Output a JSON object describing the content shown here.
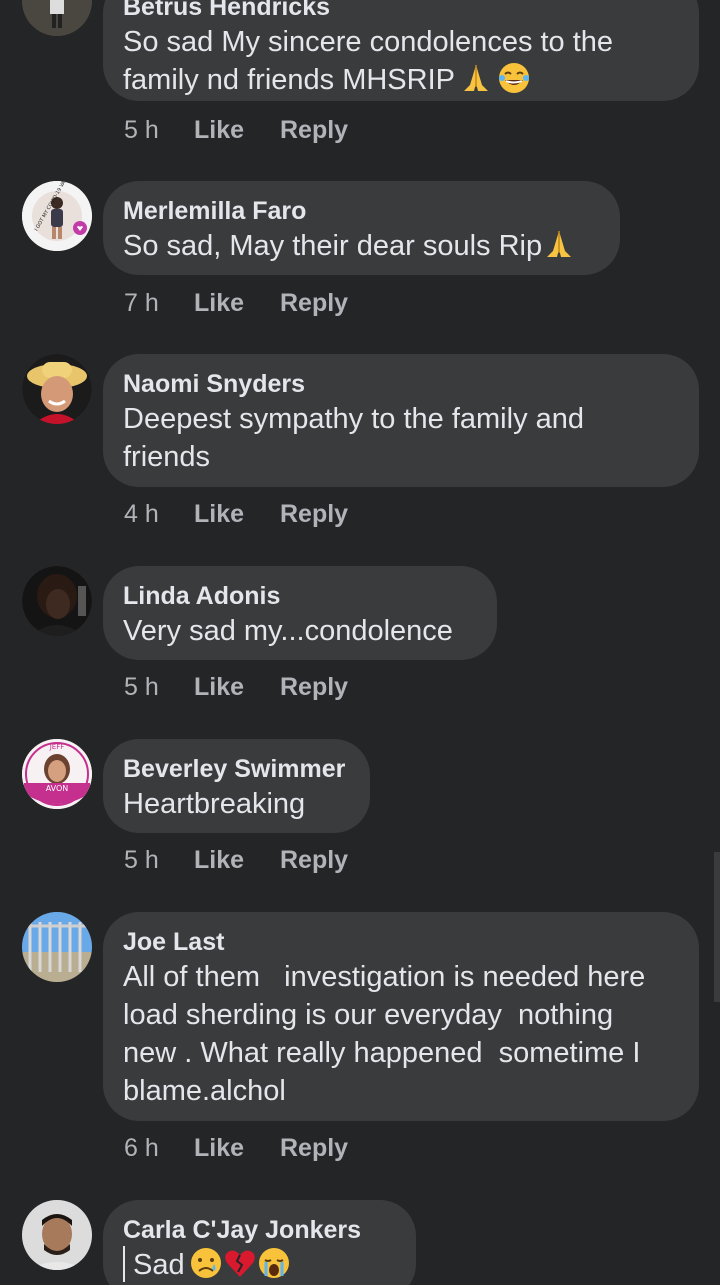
{
  "comments": [
    {
      "name": "Betrus Hendricks",
      "text": "So sad My sincere condolences to the\nfamily nd friends MHSRIP",
      "time": "5 h",
      "like": "Like",
      "reply": "Reply"
    },
    {
      "name": "Merlemilla Faro",
      "text": "So sad, May their dear souls Rip",
      "avatar_caption": "I GOT MY COVID-19 VACCINE",
      "time": "7 h",
      "like": "Like",
      "reply": "Reply"
    },
    {
      "name": "Naomi Snyders",
      "text": "Deepest sympathy to the family and\nfriends",
      "time": "4 h",
      "like": "Like",
      "reply": "Reply"
    },
    {
      "name": "Linda Adonis",
      "text": "Very sad my...condolence",
      "time": "5 h",
      "like": "Like",
      "reply": "Reply"
    },
    {
      "name": "Beverley Swimmer",
      "text": "Heartbreaking",
      "avatar_caption_top": "JEFF",
      "avatar_caption_brand": "AVON",
      "time": "5 h",
      "like": "Like",
      "reply": "Reply"
    },
    {
      "name": "Joe Last",
      "text": "All of them   investigation is needed here\nload sherding is our everyday  nothing\nnew . What really happened  sometime I\nblame.alchol",
      "time": "6 h",
      "like": "Like",
      "reply": "Reply"
    },
    {
      "name": "Carla C'Jay Jonkers",
      "text": "Sad"
    }
  ],
  "icons": [
    "folded-hands-emoji",
    "tears-of-joy-emoji",
    "sad-face-emoji",
    "broken-heart-emoji",
    "crying-face-emoji"
  ],
  "colors": {
    "background": "#242526",
    "bubble": "#3a3b3c",
    "text": "#e4e6eb",
    "meta": "#b0b3b8"
  }
}
